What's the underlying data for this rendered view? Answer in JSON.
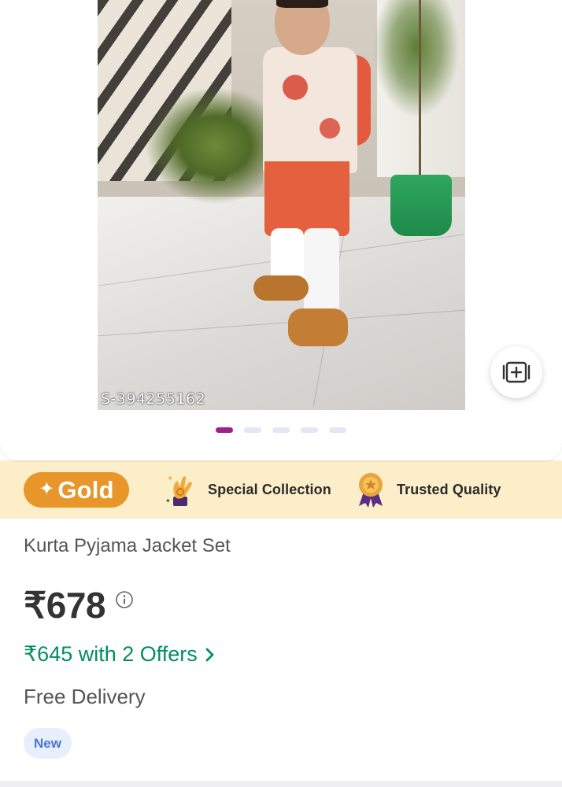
{
  "product_image": {
    "watermark": "S-394255162",
    "carousel_count": 5,
    "active_index": 0
  },
  "icons": {
    "add_to_collection": "add-square-icon",
    "gold_spark": "sparkle-icon",
    "special_collection": "ok-hand-icon",
    "trusted_quality": "medal-icon",
    "price_info": "info-icon",
    "offers_arrow": "chevron-right-icon"
  },
  "badges": {
    "gold_label": "Gold",
    "special_label": "Special Collection",
    "trusted_label": "Trusted Quality"
  },
  "product": {
    "title": "Kurta Pyjama Jacket Set",
    "price": "₹678",
    "offer_text": "₹645 with 2 Offers",
    "delivery": "Free Delivery",
    "tag": "New"
  },
  "colors": {
    "brand": "#9f2089",
    "gold": "#e8962a",
    "badge_strip": "#fbeec8",
    "offer_green": "#038d63",
    "new_tag_bg": "#e7eefc",
    "new_tag_text": "#4a76c9"
  }
}
